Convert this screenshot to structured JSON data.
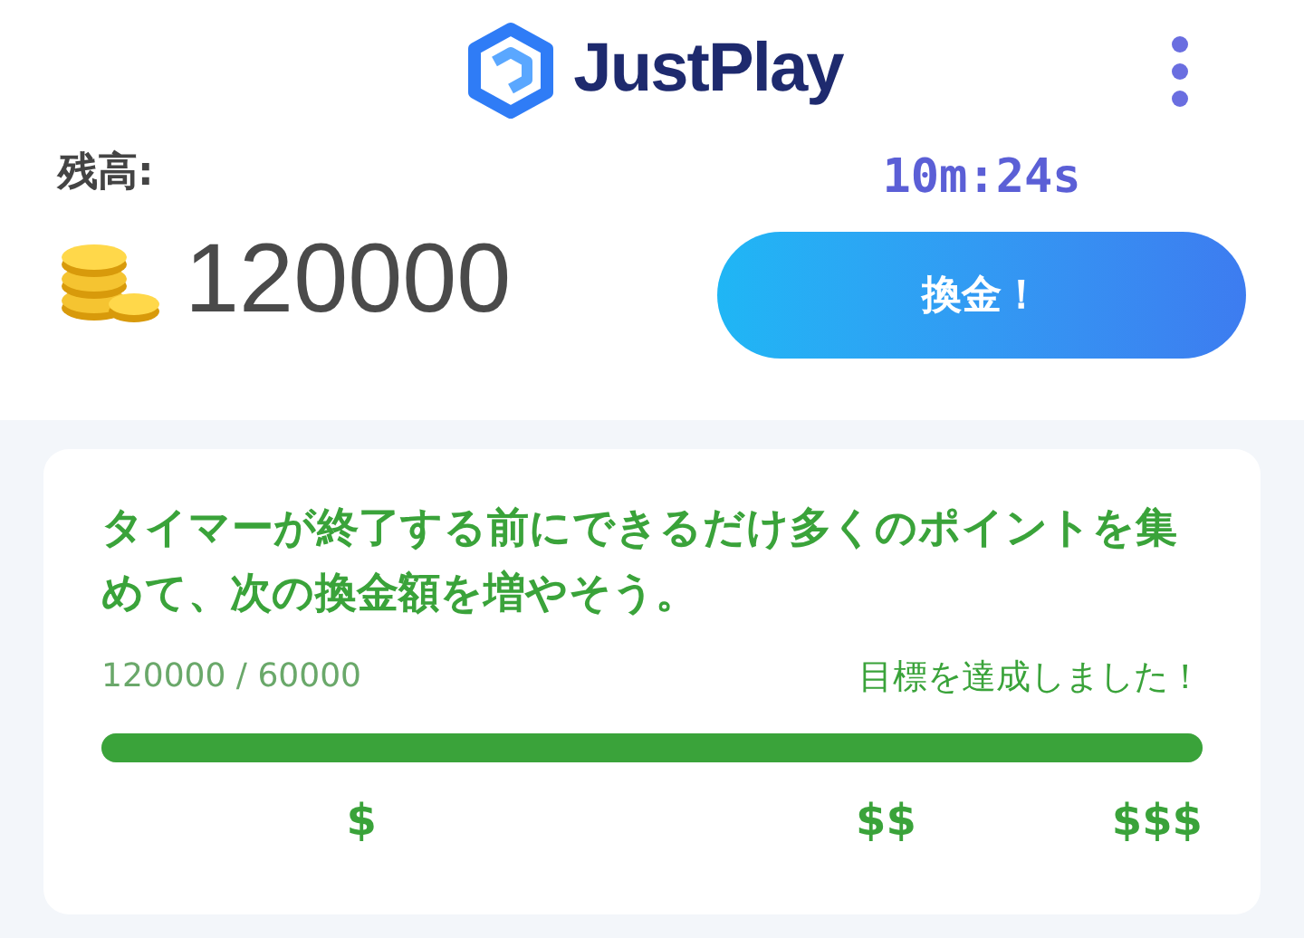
{
  "header": {
    "logo_text": "JustPlay"
  },
  "balance": {
    "label": "残高:",
    "amount": "120000"
  },
  "timer": "10m:24s",
  "cashout_button": "換金！",
  "goal_card": {
    "message": "タイマーが終了する前にできるだけ多くのポイントを集めて、次の換金額を増やそう。",
    "progress_text": "120000 / 60000",
    "status": "目標を達成しました！",
    "level": 1,
    "milestones": [
      "$",
      "$$",
      "$$$"
    ]
  }
}
